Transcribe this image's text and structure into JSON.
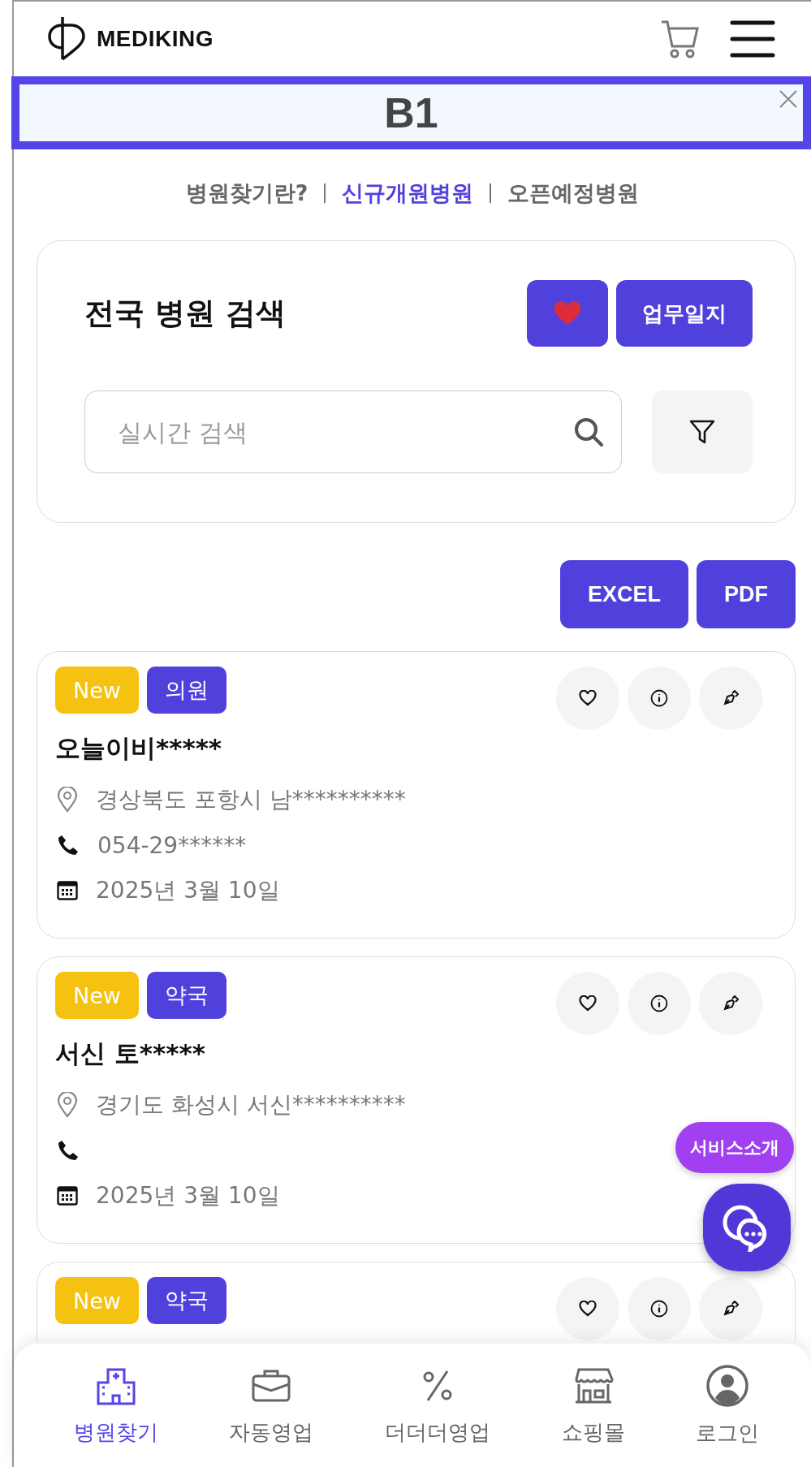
{
  "header": {
    "logo_text": "MEDIKING"
  },
  "banner": {
    "text": "B1"
  },
  "nav_links": [
    {
      "label": "병원찾기란?",
      "selected": false
    },
    {
      "label": "신규개원병원",
      "selected": true
    },
    {
      "label": "오픈예정병원",
      "selected": false
    }
  ],
  "search_panel": {
    "title": "전국 병원 검색",
    "journal_button": "업무일지",
    "search": {
      "placeholder": "실시간 검색"
    }
  },
  "export_buttons": [
    "EXCEL",
    "PDF"
  ],
  "results": [
    {
      "tags": [
        {
          "label": "New",
          "color": "#f5c211"
        },
        {
          "label": "의원",
          "color": "#5141dc"
        }
      ],
      "name": "오늘이비*****",
      "address": "경상북도 포항시 남**********",
      "phone": "054-29******",
      "date": "2025년 3월 10일"
    },
    {
      "tags": [
        {
          "label": "New",
          "color": "#f5c211"
        },
        {
          "label": "약국",
          "color": "#5141dc"
        }
      ],
      "name": "서신 토*****",
      "address": "경기도 화성시 서신**********",
      "date": "2025년 3월 10일"
    },
    {
      "tags": [
        {
          "label": "New",
          "color": "#f5c211"
        },
        {
          "label": "약국",
          "color": "#5141dc"
        }
      ]
    }
  ],
  "floating": {
    "service_button": "서비스소개"
  },
  "bottom_nav": [
    {
      "label": "병원찾기",
      "selected": true
    },
    {
      "label": "자동영업",
      "selected": false
    },
    {
      "label": "더더더영업",
      "selected": false
    },
    {
      "label": "쇼핑몰",
      "selected": false
    },
    {
      "label": "로그인",
      "selected": false
    }
  ]
}
